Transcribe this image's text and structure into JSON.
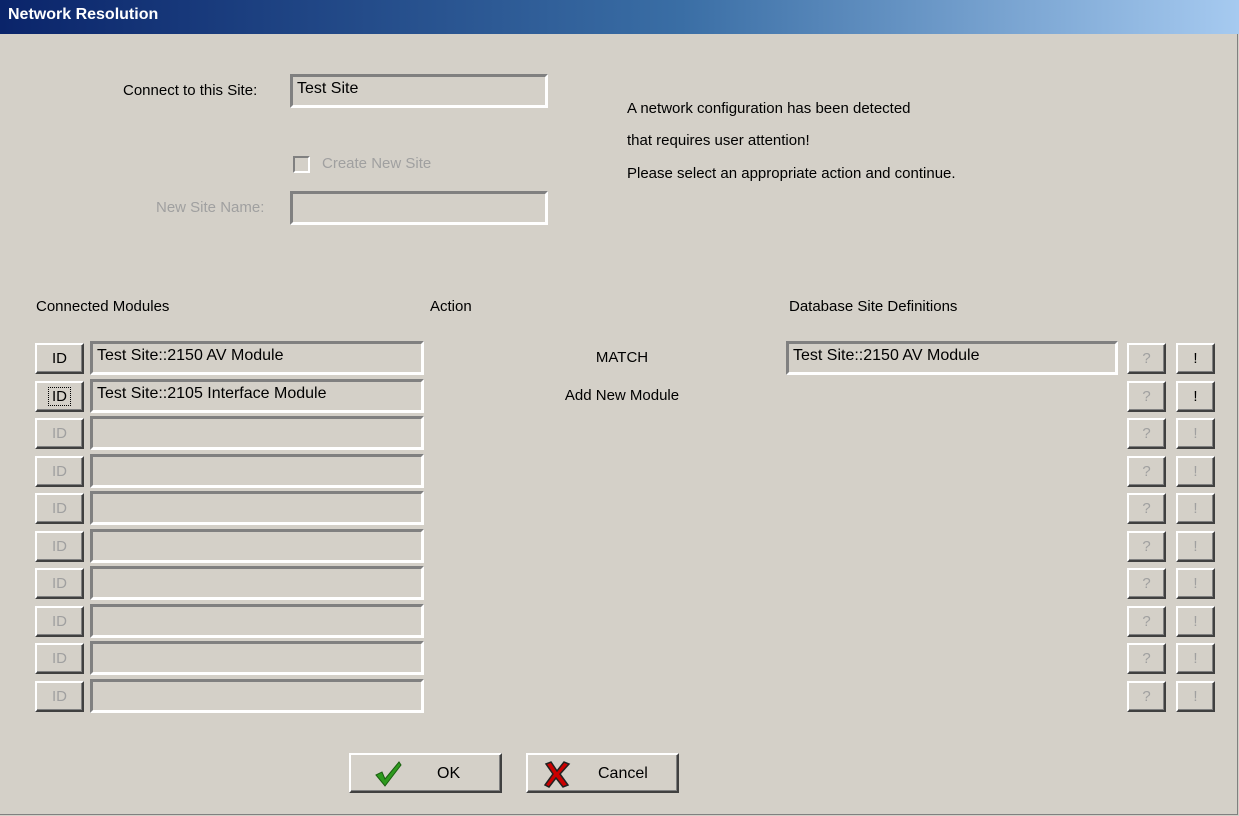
{
  "window": {
    "title": "Network Resolution"
  },
  "site": {
    "connect_label": "Connect to this Site:",
    "connect_value": "Test Site",
    "create_new_label": "Create New Site",
    "new_site_name_label": "New Site Name:",
    "new_site_name_value": ""
  },
  "message": {
    "line1": "A network configuration has been detected",
    "line2": "that requires user attention!",
    "line3": "Please select an appropriate action and continue."
  },
  "columns": {
    "modules": "Connected Modules",
    "action": "Action",
    "definitions": "Database Site Definitions"
  },
  "rows": [
    {
      "id_label": "ID",
      "module": "Test Site::2150 AV Module",
      "action": "MATCH",
      "definition": "Test Site::2150 AV Module",
      "query": "?",
      "apply": "!"
    },
    {
      "id_label": "ID",
      "module": "Test Site::2105 Interface Module",
      "action": "Add New Module",
      "definition": "",
      "query": "?",
      "apply": "!"
    },
    {
      "id_label": "ID",
      "module": "",
      "action": "",
      "definition": "",
      "query": "?",
      "apply": "!"
    },
    {
      "id_label": "ID",
      "module": "",
      "action": "",
      "definition": "",
      "query": "?",
      "apply": "!"
    },
    {
      "id_label": "ID",
      "module": "",
      "action": "",
      "definition": "",
      "query": "?",
      "apply": "!"
    },
    {
      "id_label": "ID",
      "module": "",
      "action": "",
      "definition": "",
      "query": "?",
      "apply": "!"
    },
    {
      "id_label": "ID",
      "module": "",
      "action": "",
      "definition": "",
      "query": "?",
      "apply": "!"
    },
    {
      "id_label": "ID",
      "module": "",
      "action": "",
      "definition": "",
      "query": "?",
      "apply": "!"
    },
    {
      "id_label": "ID",
      "module": "",
      "action": "",
      "definition": "",
      "query": "?",
      "apply": "!"
    },
    {
      "id_label": "ID",
      "module": "",
      "action": "",
      "definition": "",
      "query": "?",
      "apply": "!"
    }
  ],
  "buttons": {
    "ok": "OK",
    "cancel": "Cancel"
  },
  "icons": {
    "ok": "checkmark-icon",
    "cancel": "red-x-icon"
  },
  "colors": {
    "title_start": "#0a246a",
    "title_end": "#a6caf0",
    "face": "#d4d0c8",
    "check_green": "#2e9a1e",
    "x_red": "#cc0000"
  }
}
